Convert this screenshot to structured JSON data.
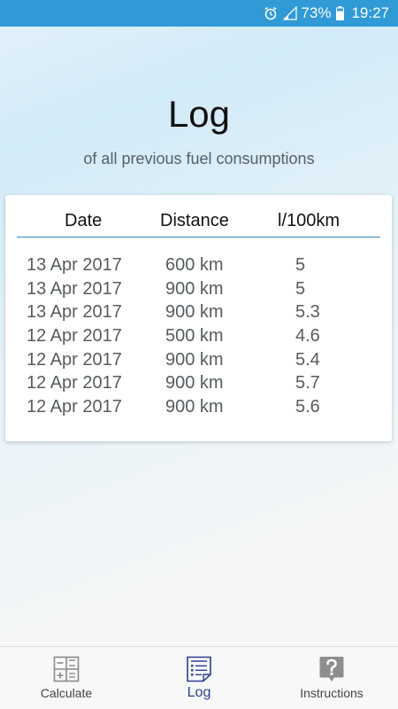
{
  "status_bar": {
    "battery": "73%",
    "time": "19:27",
    "icons": [
      "alarm-icon",
      "signal-icon",
      "battery-icon"
    ],
    "background": "#2f9ad6"
  },
  "header": {
    "title": "Log",
    "subtitle": "of all previous fuel consumptions"
  },
  "table": {
    "columns": [
      "Date",
      "Distance",
      "l/100km"
    ],
    "rows": [
      {
        "date": "13 Apr 2017",
        "distance": "600 km",
        "consumption": "5"
      },
      {
        "date": "13 Apr 2017",
        "distance": "900 km",
        "consumption": "5"
      },
      {
        "date": "13 Apr 2017",
        "distance": "900 km",
        "consumption": "5.3"
      },
      {
        "date": "12 Apr 2017",
        "distance": "500 km",
        "consumption": "4.6"
      },
      {
        "date": "12 Apr 2017",
        "distance": "900 km",
        "consumption": "5.4"
      },
      {
        "date": "12 Apr 2017",
        "distance": "900 km",
        "consumption": "5.7"
      },
      {
        "date": "12 Apr 2017",
        "distance": "900 km",
        "consumption": "5.6"
      }
    ],
    "accent": "#2a8ac6"
  },
  "bottom_nav": {
    "items": [
      {
        "label": "Calculate",
        "icon": "calculator-icon",
        "active": false
      },
      {
        "label": "Log",
        "icon": "log-list-icon",
        "active": true
      },
      {
        "label": "Instructions",
        "icon": "help-icon",
        "active": false
      }
    ],
    "active_color": "#2b3d8f"
  }
}
